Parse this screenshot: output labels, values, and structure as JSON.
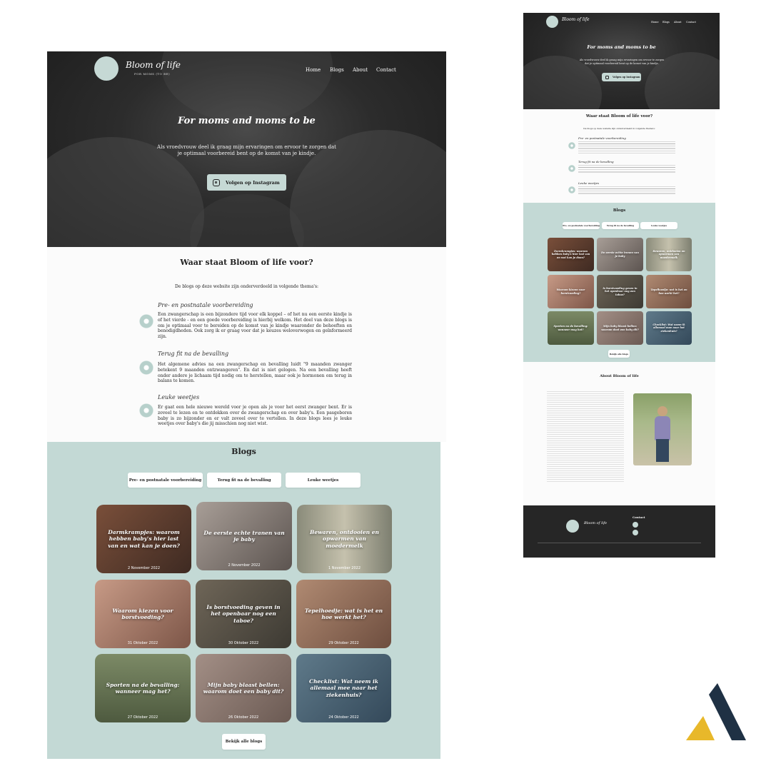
{
  "site": {
    "logo_title": "Bloom of life",
    "logo_sub": "FOR MOMS (TO BE)"
  },
  "nav": {
    "home": "Home",
    "blogs": "Blogs",
    "about": "About",
    "contact": "Contact"
  },
  "hero": {
    "title": "For moms and moms to be",
    "text": "Als vroedvrouw deel ik graag mijn ervaringen om ervoor te zorgen dat je optimaal voorbereid bent op de komst van je kindje.",
    "button": "Volgen op Instagram"
  },
  "about_values": {
    "heading": "Waar staat Bloom of life voor?",
    "intro": "De blogs op deze website zijn onderverdeeld in volgende thema's:",
    "themes": [
      {
        "title": "Pre- en postnatale voorbereiding",
        "text": "Een zwangerschap is een bijzondere tijd voor elk koppel – of het nu een eerste kindje is of het vierde - en een goede voorbereiding is hierbij welkom. Het doel van deze blogs is om je optimaal voor te bereiden op de komst van je kindje waaronder de behoeften en benodigdheden. Ook zorg ik er graag voor dat je keuzes weloverwogen en geïnformeerd zijn."
      },
      {
        "title": "Terug fit na de bevalling",
        "text": "Het algemene advies na een zwangerschap en bevalling luidt \"9 maanden zwanger betekent 9 maanden ontzwangeren\". En dat is niet gelogen. Na een bevalling heeft onder andere je lichaam tijd nodig om te herstellen, maar ook je hormonen om terug in balans te komen."
      },
      {
        "title": "Leuke weetjes",
        "text": "Er gaat een hele nieuwe wereld voor je open als je voor het eerst zwanger bent. Er is zoveel te lezen en te ontdekken over de zwangerschap en over baby's. Een pasgeboren baby is zo bijzonder en er valt zoveel over te vertellen. In deze blogs lees je leuke weetjes over baby's die jij misschien nog niet wist."
      }
    ]
  },
  "blogs": {
    "heading": "Blogs",
    "filters": [
      "Pre- en postnatale voorbereiding",
      "Terug fit na de bevalling",
      "Leuke weetjes"
    ],
    "posts": [
      {
        "title": "Darmkrampjes: waarom hebben baby's hier last van en wat kan je doen?",
        "date": "2 November 2022"
      },
      {
        "title": "De eerste echte tranen van je baby",
        "date": "2 November 2022"
      },
      {
        "title": "Bewaren, ontdooien en opwarmen van moedermelk",
        "date": "1 November 2022"
      },
      {
        "title": "Waarom kiezen voor borstvoeding?",
        "date": "31 Oktober 2022"
      },
      {
        "title": "Is borstvoeding geven in het openbaar nog een taboe?",
        "date": "30 Oktober 2022"
      },
      {
        "title": "Tepelhoedje: wat is het en hoe werkt het?",
        "date": "29 Oktober 2022"
      },
      {
        "title": "Sporten na de bevalling: wanneer mag het?",
        "date": "27 Oktober 2022"
      },
      {
        "title": "Mijn baby blaast bellen: waarom doet een baby dit?",
        "date": "26 Oktober 2022"
      },
      {
        "title": "Checklist: Wat neem ik allemaal mee naar het ziekenhuis?",
        "date": "24 Oktober 2022"
      }
    ],
    "all_button": "Bekijk alle blogs"
  },
  "about": {
    "heading": "About Bloom of life"
  },
  "footer": {
    "contact_heading": "Contact"
  },
  "colors": {
    "mint": "#c3d9d5",
    "dark": "#262626",
    "accent_yellow": "#e8b82a",
    "accent_navy": "#1f3144"
  }
}
